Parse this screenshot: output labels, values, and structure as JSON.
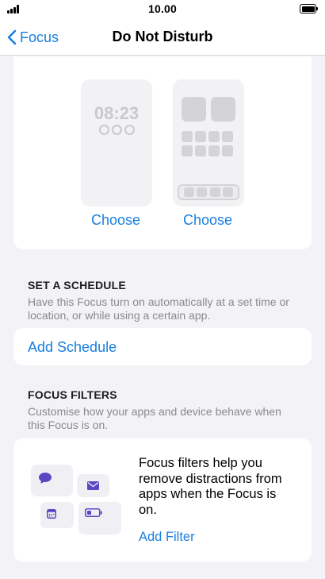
{
  "status_bar": {
    "time": "10.00"
  },
  "nav": {
    "back_label": "Focus",
    "title": "Do Not Disturb"
  },
  "preview": {
    "lock_screen_time": "08:23",
    "choose_lock_label": "Choose",
    "choose_home_label": "Choose"
  },
  "schedule": {
    "header": "SET A SCHEDULE",
    "description": "Have this Focus turn on automatically at a set time or location, or while using a certain app.",
    "add_label": "Add Schedule"
  },
  "filters": {
    "header": "FOCUS FILTERS",
    "description": "Customise how your apps and device behave when this Focus is on.",
    "body": "Focus filters help you remove distractions from apps when the Focus is on.",
    "add_label": "Add Filter"
  },
  "colors": {
    "accent": "#1a7fe0",
    "icon_purple": "#5b47c6",
    "background": "#f2f2f7"
  }
}
